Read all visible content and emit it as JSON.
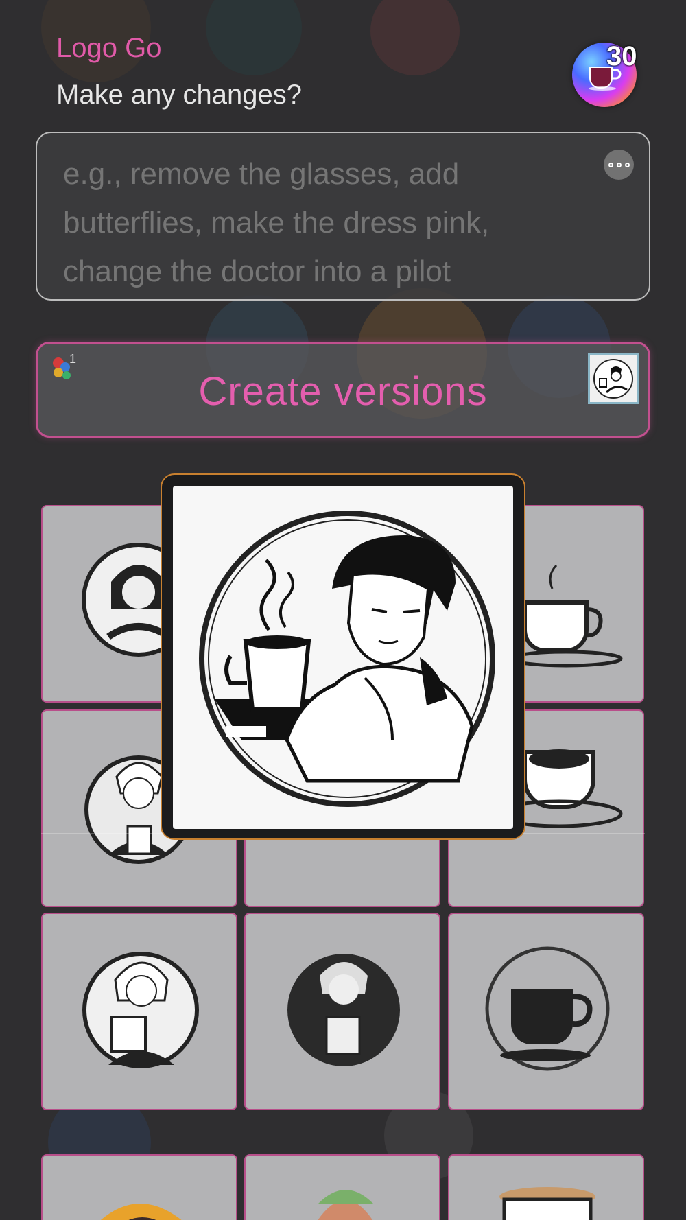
{
  "header": {
    "app_title": "Logo Go",
    "subtitle": "Make any changes?",
    "credits": "30",
    "credits_icon": "coffee-cup-gradient-icon"
  },
  "prompt": {
    "placeholder": "e.g., remove the glasses, add butterflies, make the dress pink, change the doctor into a pilot",
    "more_icon": "ellipsis-icon"
  },
  "create": {
    "label": "Create versions",
    "mix_count": "1"
  },
  "colors": {
    "accent": "#e05aa8",
    "tile_border": "#b84f8a",
    "preview_border": "#c8802f",
    "background": "#2f2e30"
  },
  "grid": {
    "tiles": [
      {
        "subject": "anime girl with cap logo"
      },
      {
        "subject": "anime boy with coffee (selected)"
      },
      {
        "subject": "coffee cup with steam logo"
      },
      {
        "subject": "anime boy with coffee cup logo"
      },
      {
        "subject": "coffee logo"
      },
      {
        "subject": "coffee cup on saucer logo"
      },
      {
        "subject": "anime girl with frappe logo"
      },
      {
        "subject": "anime boy with drink logo"
      },
      {
        "subject": "coffee cup in circle logo"
      },
      {
        "subject": "partial logo"
      },
      {
        "subject": "partial anime logo"
      },
      {
        "subject": "partial latte logo"
      }
    ]
  },
  "preview": {
    "subject": "anime boy holding steaming coffee cup logo"
  }
}
